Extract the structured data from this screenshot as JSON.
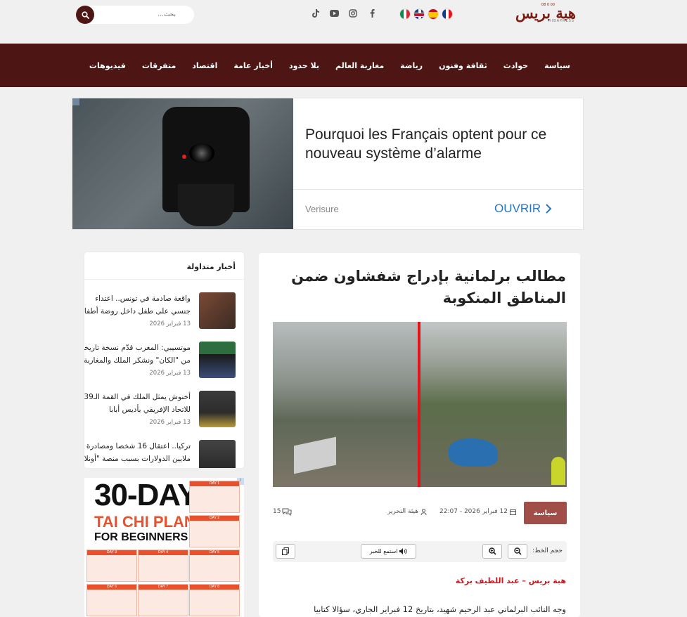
{
  "header": {
    "logo_text": "هبة بريس",
    "logo_sub": "HIBAPRESS",
    "logo_tiny": "08 0 00",
    "languages": [
      {
        "name": "french-flag",
        "colors": [
          "#0b3d91",
          "#ffffff",
          "#e2131a"
        ]
      },
      {
        "name": "spanish-flag",
        "colors": [
          "#c60b1e",
          "#ffc400",
          "#c60b1e"
        ]
      },
      {
        "name": "english-flag",
        "colors": []
      },
      {
        "name": "italian-flag",
        "colors": [
          "#009246",
          "#ffffff",
          "#ce2b37"
        ]
      }
    ],
    "socials": [
      "facebook-icon",
      "instagram-icon",
      "youtube-icon",
      "tiktok-icon"
    ],
    "search_placeholder": "بحث..."
  },
  "nav": {
    "items": [
      "سياسة",
      "حوادث",
      "ثقافة وفنون",
      "رياضة",
      "مغاربة العالم",
      "بلا حدود",
      "أخبار عامة",
      "اقتصاد",
      "متفرقات",
      "فيديوهات"
    ]
  },
  "ad": {
    "headline": "Pourquoi les Français optent pour ce nouveau système d’alarme",
    "brand": "Verisure",
    "cta": "OUVRIR"
  },
  "sidebar": {
    "title": "أخبار متداولة",
    "items": [
      {
        "title1": "واقعة صادمة في تونس.. اعتداء",
        "title2": "جنسي على طفل داخل روضة أطفال",
        "date": "13 فبراير 2026"
      },
      {
        "title1": "موتسيبي: المغرب قدّم نسخة تاريخية",
        "title2": "من \"الكان\" ونشكر الملك والمغاربة",
        "date": "13 فبراير 2026"
      },
      {
        "title1": "أخنوش يمثل الملك في القمة الـ39",
        "title2": "للاتحاد الإفريقي بأديس أبابا",
        "date": "13 فبراير 2026"
      },
      {
        "title1": "تركيا.. اعتقال 16 شخصا ومصادرة",
        "title2": "ملايين الدولارات بسبب منصة \"أونلاين\"",
        "date": ""
      }
    ]
  },
  "side_ad": {
    "line1": "30-DAY",
    "line2": "TAI CHI PLAN",
    "line3": "FOR BEGINNERS",
    "days": [
      "DAY 1",
      "DAY 2",
      "DAY 3",
      "DAY 4",
      "DAY 5",
      "DAY 6",
      "DAY 7",
      "DAY 8"
    ]
  },
  "article": {
    "title": "مطالب برلمانية بإدراج شفشاون ضمن المناطق المنكوبة",
    "category": "سياسة",
    "author": "هيئة التحرير",
    "date": "12 فبراير 2026 - 22:07",
    "comments": "15",
    "font_size_label": "حجم الخط:",
    "listen_label": "استمع للخبر",
    "byline": "هبة بريس – عبد اللطيف بركة",
    "body": "وجه النائب البرلماني عبد الرحيم شهيد، بتاريخ 12 فبراير الجاري، سؤالا كتابيا"
  },
  "colors": {
    "brand": "#4d1614",
    "category": "#a24e48",
    "accent_red": "#d2181f",
    "cta_blue": "#2676c8"
  }
}
